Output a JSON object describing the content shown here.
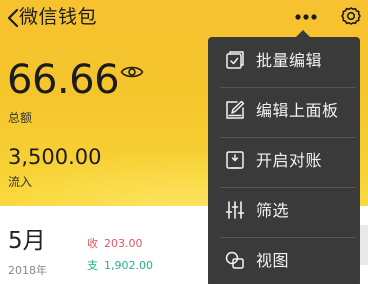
{
  "header": {
    "title": "微信钱包"
  },
  "wallet": {
    "balance": "66.66",
    "balance_label": "总额",
    "inflow_amount": "3,500.00",
    "inflow_label": "流入"
  },
  "summary": {
    "month": "5月",
    "year": "2018年",
    "expense_tag": "收",
    "expense_value": "203.00",
    "income_tag": "支",
    "income_value": "1,902.00"
  },
  "menu": {
    "items": [
      {
        "label": "批量编辑",
        "icon": "batch-edit-icon"
      },
      {
        "label": "编辑上面板",
        "icon": "edit-panel-icon"
      },
      {
        "label": "开启对账",
        "icon": "reconcile-icon"
      },
      {
        "label": "筛选",
        "icon": "filter-icon"
      },
      {
        "label": "视图",
        "icon": "view-icon"
      }
    ]
  },
  "colors": {
    "hero_yellow": "#f6c230",
    "menu_bg": "#3a3a3a",
    "expense_red": "#e3556a",
    "income_green": "#20b48c"
  }
}
